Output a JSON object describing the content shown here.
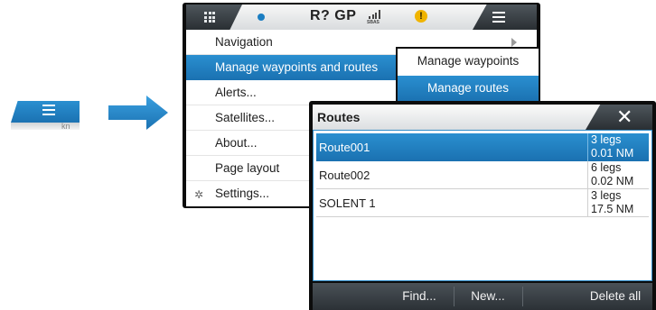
{
  "topbar": {
    "status": "R? GP",
    "sbas": "SBAS",
    "warning": "!"
  },
  "menu": {
    "items": [
      {
        "label": "Navigation"
      },
      {
        "label": "Manage waypoints and routes"
      },
      {
        "label": "Alerts..."
      },
      {
        "label": "Satellites..."
      },
      {
        "label": "About..."
      },
      {
        "label": "Page layout"
      },
      {
        "label": "Settings..."
      }
    ]
  },
  "submenu": {
    "items": [
      {
        "label": "Manage waypoints"
      },
      {
        "label": "Manage routes"
      }
    ]
  },
  "routes": {
    "title": "Routes",
    "close": "✕",
    "rows": [
      {
        "name": "Route001",
        "legs": "3 legs",
        "dist": "0.01 NM"
      },
      {
        "name": "Route002",
        "legs": "6 legs",
        "dist": "0.02 NM"
      },
      {
        "name": "SOLENT 1",
        "legs": "3 legs",
        "dist": "17.5 NM"
      }
    ],
    "footer": {
      "find": "Find...",
      "new": "New...",
      "delete_all": "Delete all"
    }
  },
  "mini_tab": {
    "text": "kn"
  },
  "colors": {
    "accent": "#1b7ec2",
    "dark_bar": "#2c3136",
    "warning": "#f0b400"
  },
  "icons": {
    "apps": "grid-icon",
    "menu": "hamburger-icon",
    "settings": "gear-icon",
    "close": "close-icon",
    "submenu": "chevron-right-icon",
    "arrow": "arrow-right-icon"
  }
}
